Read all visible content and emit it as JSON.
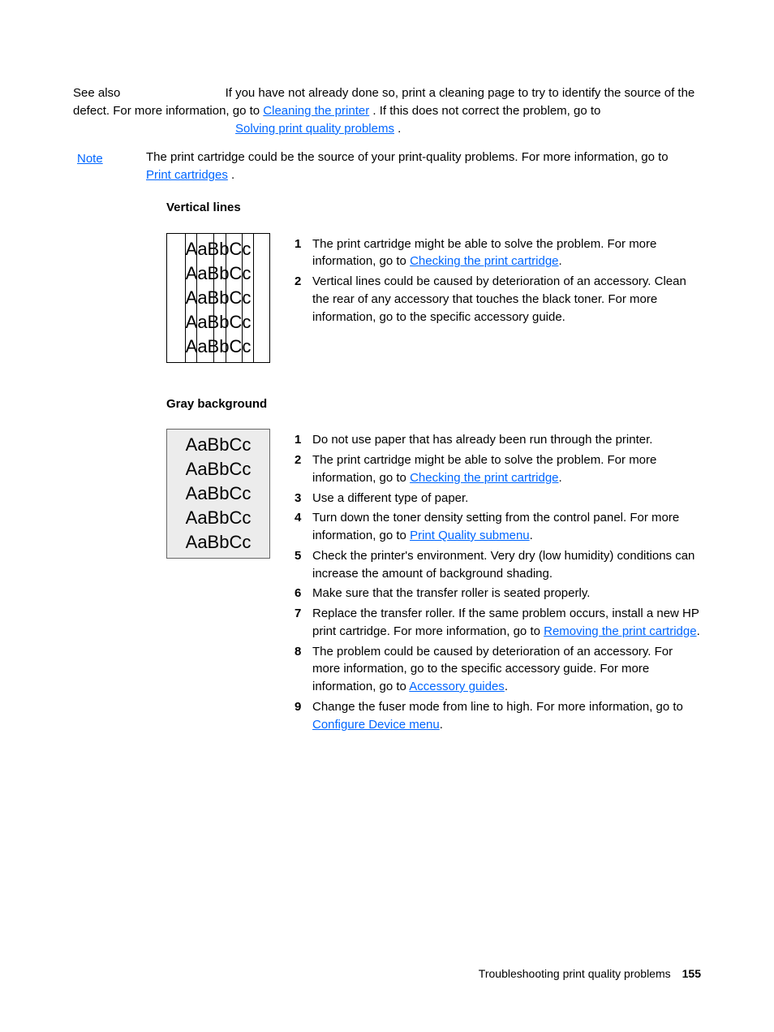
{
  "see_also": "See also",
  "intro_text_1": "If you have not already done so, print a cleaning page to try to identify the source of the defect. For more information, go to ",
  "link_cleaning_page": "Cleaning the printer",
  "intro_text_2": ". If this does not correct the problem, go to ",
  "link_solving_problems": "Solving print quality problems",
  "period": ".",
  "note_label": "Note",
  "note_text_1": "The print cartridge could be the source of your print-quality problems. For more information, go to ",
  "link_print_cartridges": "Print cartridges",
  "sections": [
    {
      "heading": "Vertical lines",
      "items": [
        {
          "num": "1",
          "text_pre": "The print cartridge might be able to solve the problem. For more information, go to ",
          "link": "Checking the print cartridge",
          "text_post": "."
        },
        {
          "num": "2",
          "text_pre": "Vertical lines could be caused by deterioration of an accessory. Clean the rear of any accessory that touches the black toner. For more information, go to ",
          "link": "",
          "text_post": "the specific accessory guide."
        }
      ],
      "figure": "fig1"
    },
    {
      "heading": "Gray background",
      "items": [
        {
          "num": "1",
          "text_pre": "Do not use paper that has already been run through the printer.",
          "link": "",
          "text_post": ""
        },
        {
          "num": "2",
          "text_pre": "The print cartridge might be able to solve the problem. For more information, go to ",
          "link": "Checking the print cartridge",
          "text_post": "."
        },
        {
          "num": "3",
          "text_pre": "Use a different type of paper.",
          "link": "",
          "text_post": ""
        },
        {
          "num": "4",
          "text_pre": "Turn down the toner density setting from the control panel. For more information, go to ",
          "link": "Print Quality submenu",
          "text_post": "."
        },
        {
          "num": "5",
          "text_pre": "Check the printer's environment. Very dry (low humidity) conditions can increase the amount of background shading.",
          "link": "",
          "text_post": ""
        },
        {
          "num": "6",
          "text_pre": "Make sure that the transfer roller is seated properly.",
          "link": "",
          "text_post": ""
        },
        {
          "num": "7",
          "text_pre": "Replace the transfer roller. If the same problem occurs, install a new HP print cartridge. For more information, go to ",
          "link": "Removing the print cartridge",
          "text_post": "."
        },
        {
          "num": "8",
          "text_pre": "The problem could be caused by deterioration of an accessory. For more information, go to the specific accessory guide. For more information, go to ",
          "link": "Accessory guides",
          "text_post": "."
        },
        {
          "num": "9",
          "text_pre": "Change the fuser mode from line to high. For more information, go to ",
          "link": "Configure Device menu",
          "text_post": "."
        }
      ],
      "figure": "fig2"
    }
  ],
  "sample_text": "AaBbCc",
  "vline_positions": [
    22,
    36,
    57,
    72,
    92,
    106
  ],
  "footer_text": "Troubleshooting print quality problems",
  "footer_page": "155"
}
